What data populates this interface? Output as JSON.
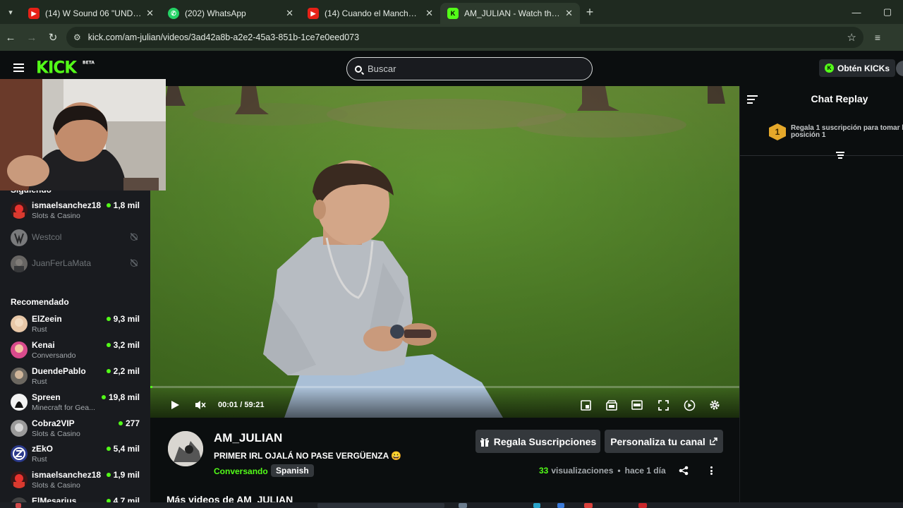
{
  "browser": {
    "tabs": [
      {
        "title": "(14) W Sound 06 \"UNDERCRONICA\"",
        "icon": "youtube-icon",
        "active": false
      },
      {
        "title": "(202) WhatsApp",
        "icon": "whatsapp-icon",
        "active": false
      },
      {
        "title": "(14) Cuando el Manchester United",
        "icon": "youtube-icon",
        "active": false
      },
      {
        "title": "AM_JULIAN - Watch the VOD on Kick",
        "icon": "kick-icon",
        "active": true
      }
    ],
    "url": "kick.com/am-julian/videos/3ad42a8b-a2e2-45a3-851b-1ce7e0eed073"
  },
  "header": {
    "logo": "KICK",
    "logo_badge": "BETA",
    "search_placeholder": "Buscar",
    "get_kicks_label": "Obtén KICKs"
  },
  "sidebar": {
    "following_title": "Siguiendo",
    "following": [
      {
        "name": "ismaelsanchez18",
        "category": "Slots & Casino",
        "viewers": "1,8 mil",
        "live": true
      },
      {
        "name": "Westcol",
        "category": "",
        "viewers": "",
        "live": false
      },
      {
        "name": "JuanFerLaMata",
        "category": "",
        "viewers": "",
        "live": false
      }
    ],
    "recommended_title": "Recomendado",
    "recommended": [
      {
        "name": "ElZeein",
        "category": "Rust",
        "viewers": "9,3 mil"
      },
      {
        "name": "Kenai",
        "category": "Conversando",
        "viewers": "3,2 mil"
      },
      {
        "name": "DuendePablo",
        "category": "Rust",
        "viewers": "2,2 mil"
      },
      {
        "name": "Spreen",
        "category": "Minecraft for Gea...",
        "viewers": "19,8 mil"
      },
      {
        "name": "Cobra2VIP",
        "category": "Slots & Casino",
        "viewers": "277"
      },
      {
        "name": "zEkO",
        "category": "Rust",
        "viewers": "5,4 mil"
      },
      {
        "name": "ismaelsanchez18",
        "category": "Slots & Casino",
        "viewers": "1,9 mil"
      },
      {
        "name": "ElMesarius",
        "category": "",
        "viewers": "4,7 mil"
      }
    ]
  },
  "player": {
    "time_current": "00:01",
    "time_separator": "/",
    "time_total": "59:21",
    "progress": 0.0003,
    "muted": true
  },
  "chat": {
    "title": "Chat Replay",
    "gift_rank": "1",
    "gift_text": "Regala 1 suscripción para tomar la posición 1"
  },
  "channel": {
    "name": "AM_JULIAN",
    "stream_title": "PRIMER IRL OJALÁ NO PASE VERGÜENZA 😀",
    "category": "Conversando",
    "language": "Spanish",
    "gift_button": "Regala Suscripciones",
    "customize_button": "Personaliza tu canal",
    "views_count": "33",
    "views_label": "visualizaciones",
    "separator": "•",
    "time_ago": "hace 1 día",
    "more_videos_title": "Más videos de AM_JULIAN"
  },
  "colors": {
    "brand_green": "#53fc18",
    "background": "#0b0e0f",
    "sidebar_bg": "#191b1f"
  }
}
